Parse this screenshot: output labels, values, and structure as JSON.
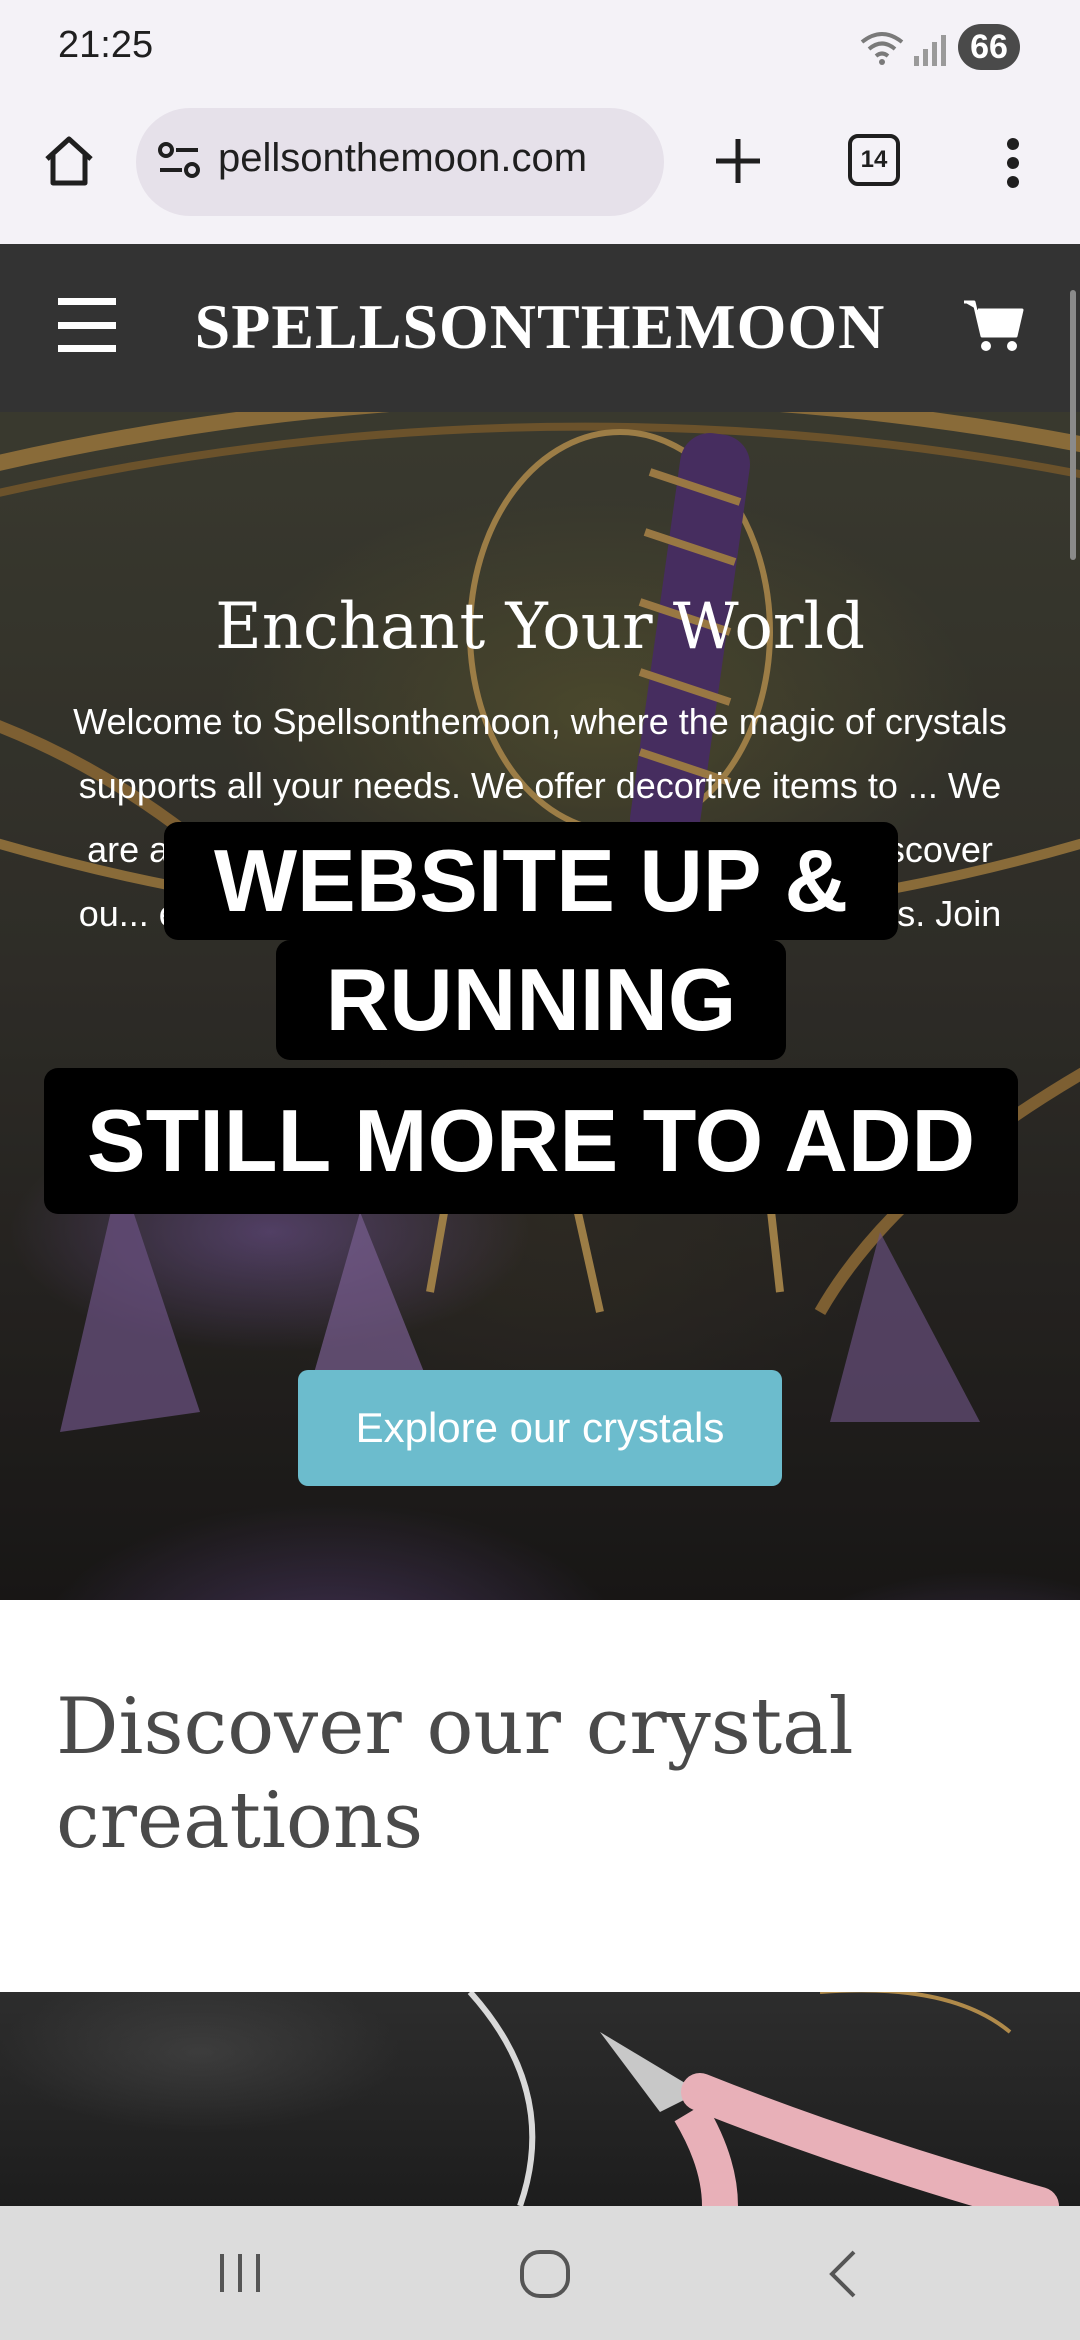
{
  "status_bar": {
    "time": "21:25",
    "battery": "66",
    "icons": [
      "wifi-icon",
      "signal-icon"
    ]
  },
  "browser": {
    "url": "pellsonthemoon.com",
    "tab_count": "14",
    "icons": [
      "home-icon",
      "site-settings-icon",
      "plus-icon",
      "more-vert-icon"
    ]
  },
  "site": {
    "title": "SPELLSONTHEMOON",
    "icons": [
      "hamburger-icon",
      "cart-icon"
    ]
  },
  "hero": {
    "heading": "Enchant Your World",
    "text": "Welcome to Spellsonthemoon, where the magic of crystals supports all your needs. We offer decortive items to ... We are also offe... special sparkle in ... one special. Discover ou... experience the ... suncatcher to suit your needs. Join us on this mystical journey!",
    "button_label": "Explore our crystals"
  },
  "captions": {
    "line1": "WEBSITE UP &",
    "line2": "RUNNING",
    "line3": "STILL MORE TO ADD"
  },
  "section": {
    "heading": "Discover our crystal creations"
  },
  "nav_bar": {
    "icons": [
      "recent-apps-icon",
      "home-circle-icon",
      "back-icon"
    ]
  },
  "colors": {
    "header_bg": "#333333",
    "button_bg": "#6cbccd",
    "chrome_bg": "#f4f2f7"
  }
}
